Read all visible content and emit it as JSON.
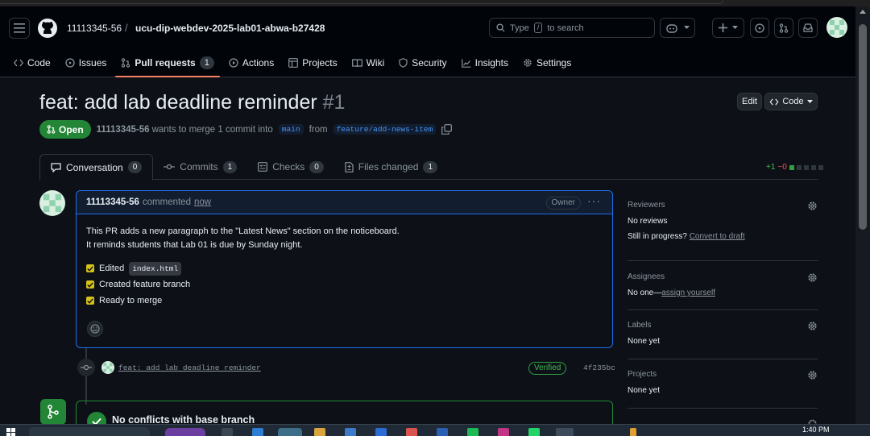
{
  "header": {
    "owner": "11113345-56",
    "separator": "/",
    "repo": "ucu-dip-webdev-2025-lab01-abwa-b27428",
    "search_placeholder_prefix": "Type",
    "search_key": "/",
    "search_placeholder_suffix": "to search"
  },
  "repo_nav": [
    {
      "label": "Code",
      "icon": "code-icon"
    },
    {
      "label": "Issues",
      "icon": "issue-icon"
    },
    {
      "label": "Pull requests",
      "icon": "pull-request-icon",
      "count": "1"
    },
    {
      "label": "Actions",
      "icon": "play-icon"
    },
    {
      "label": "Projects",
      "icon": "table-icon"
    },
    {
      "label": "Wiki",
      "icon": "book-icon"
    },
    {
      "label": "Security",
      "icon": "shield-icon"
    },
    {
      "label": "Insights",
      "icon": "graph-icon"
    },
    {
      "label": "Settings",
      "icon": "gear-icon"
    }
  ],
  "pr": {
    "title": "feat: add lab deadline reminder",
    "number": "#1",
    "state": "Open",
    "author": "11113345-56",
    "merge_text": "wants to merge 1 commit into",
    "base_branch": "main",
    "from_text": "from",
    "head_branch": "feature/add-news-item",
    "edit_label": "Edit",
    "code_label": "Code"
  },
  "tabs": [
    {
      "label": "Conversation",
      "count": "0"
    },
    {
      "label": "Commits",
      "count": "1"
    },
    {
      "label": "Checks",
      "count": "0"
    },
    {
      "label": "Files changed",
      "count": "1"
    }
  ],
  "diffstat": {
    "additions": "+1",
    "deletions": "−0"
  },
  "comment": {
    "author": "11113345-56",
    "action": "commented",
    "time": "now",
    "badge": "Owner",
    "line1": "This PR adds a new paragraph to the \"Latest News\" section on the noticeboard.",
    "line2": "It reminds students that Lab 01 is due by Sunday night.",
    "tasks": [
      {
        "text": "Edited",
        "code": "index.html"
      },
      {
        "text": "Created feature branch",
        "code": ""
      },
      {
        "text": "Ready to merge",
        "code": ""
      }
    ]
  },
  "commit": {
    "message": "feat: add lab deadline reminder",
    "verified": "Verified",
    "sha": "4f235bc"
  },
  "merge": {
    "status": "No conflicts with base branch"
  },
  "sidebar": {
    "reviewers": {
      "title": "Reviewers",
      "line1": "No reviews",
      "line2_prefix": "Still in progress?",
      "line2_link": "Convert to draft"
    },
    "assignees": {
      "title": "Assignees",
      "prefix": "No one—",
      "link": "assign yourself"
    },
    "labels": {
      "title": "Labels",
      "value": "None yet"
    },
    "projects": {
      "title": "Projects",
      "value": "None yet"
    }
  },
  "taskbar": {
    "time": "1:40 PM"
  },
  "colors": {
    "accent_green": "#238636",
    "link_blue": "#4493f8",
    "active_tab": "#f78166"
  }
}
